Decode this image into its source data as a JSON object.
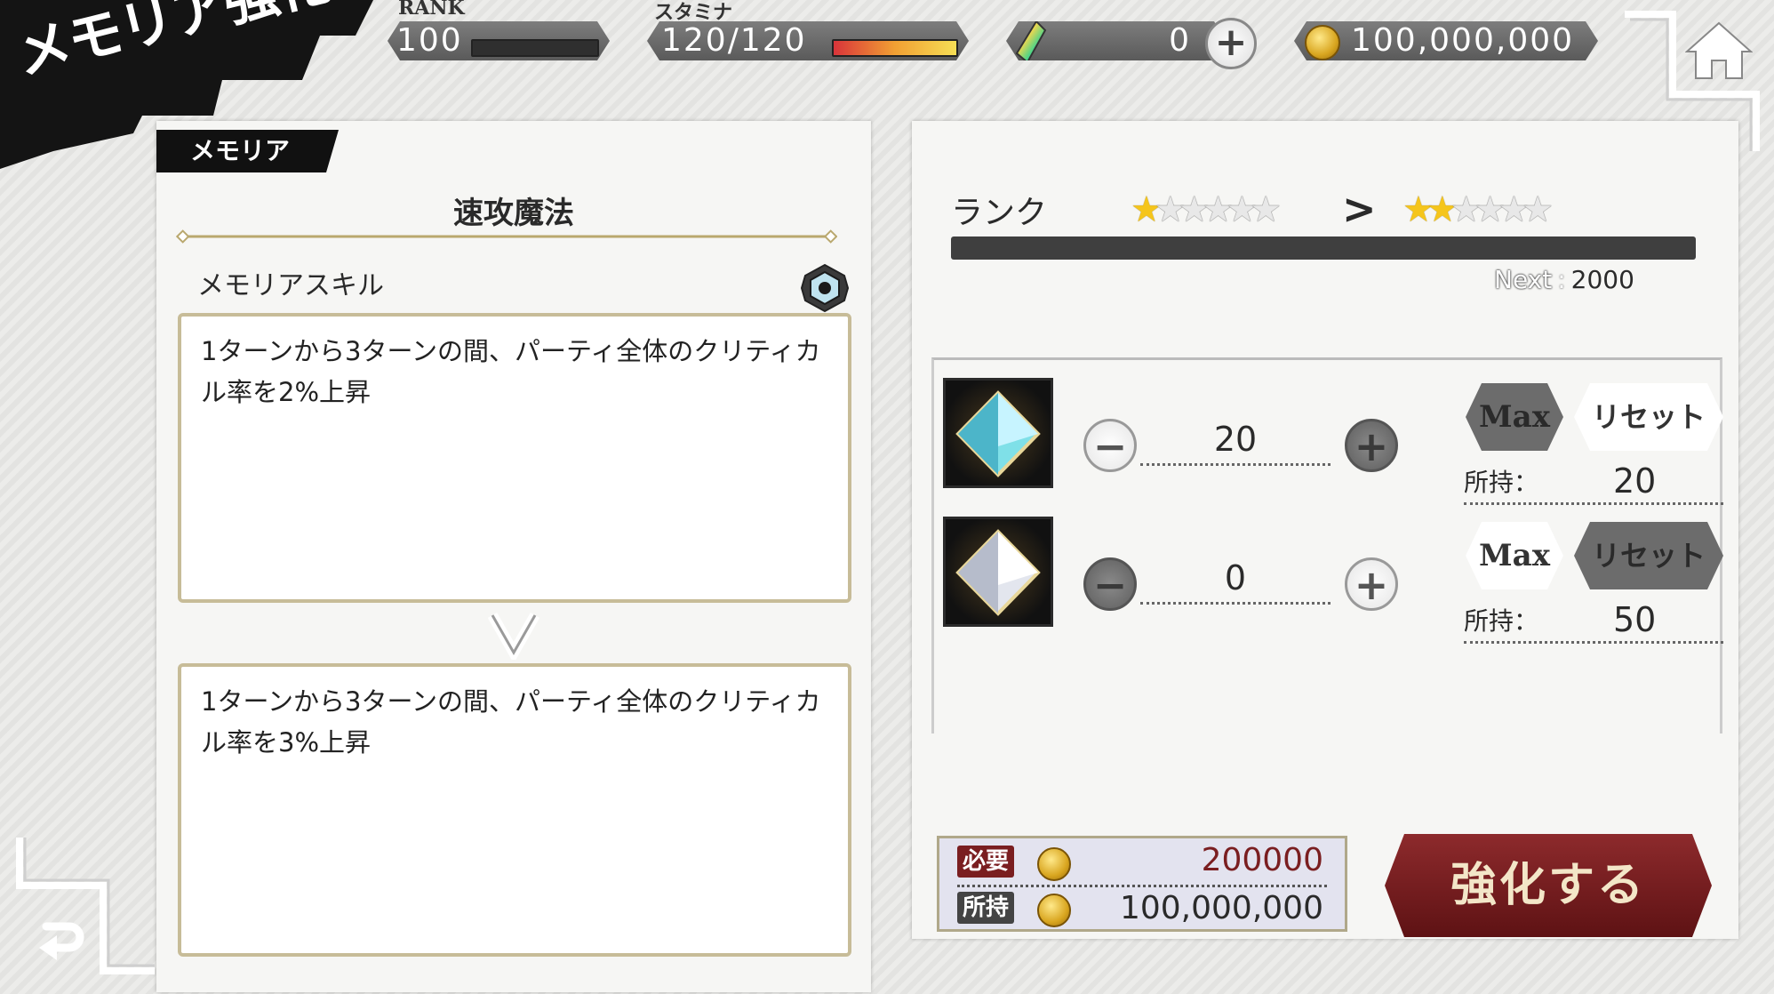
{
  "header": {
    "title": "メモリア強化",
    "rank_label": "RANK",
    "rank_value": "100",
    "rank_progress": 0.0,
    "stamina_label": "スタミナ",
    "stamina_value": "120/120",
    "stamina_progress": 1.0,
    "gems_value": "0",
    "coins_value": "100,000,000",
    "home_icon": "home-icon"
  },
  "left_panel": {
    "tag": "メモリア",
    "memoria_name": "速攻魔法",
    "skill_label": "メモリアスキル",
    "current_desc": "1ターンから3ターンの間、パーティ全体のクリティカル率を2%上昇",
    "arrow_icon": "chevron-down-icon",
    "next_desc": "1ターンから3ターンの間、パーティ全体のクリティカル率を3%上昇"
  },
  "right_panel": {
    "rank_label": "ランク",
    "current_stars": 1,
    "next_stars": 2,
    "max_stars": 6,
    "arrow": ">",
    "exp_progress": 0.0,
    "next_label": "Next",
    "next_sep": ":",
    "next_value": "2000",
    "materials": [
      {
        "icon": "prism-crystal-icon",
        "count": "20",
        "max_label": "Max",
        "reset_label": "リセット",
        "owned_label": "所持：",
        "owned_value": "20"
      },
      {
        "icon": "silver-prism-icon",
        "count": "0",
        "max_label": "Max",
        "reset_label": "リセット",
        "owned_label": "所持：",
        "owned_value": "50"
      }
    ],
    "cost": {
      "required_label": "必要",
      "required_value": "200000",
      "owned_label": "所持",
      "owned_value": "100,000,000"
    },
    "enhance_button": "強化する"
  },
  "colors": {
    "accent_red": "#7a1e20",
    "star_gold": "#f5c51b",
    "panel_border": "#c7bc98"
  }
}
